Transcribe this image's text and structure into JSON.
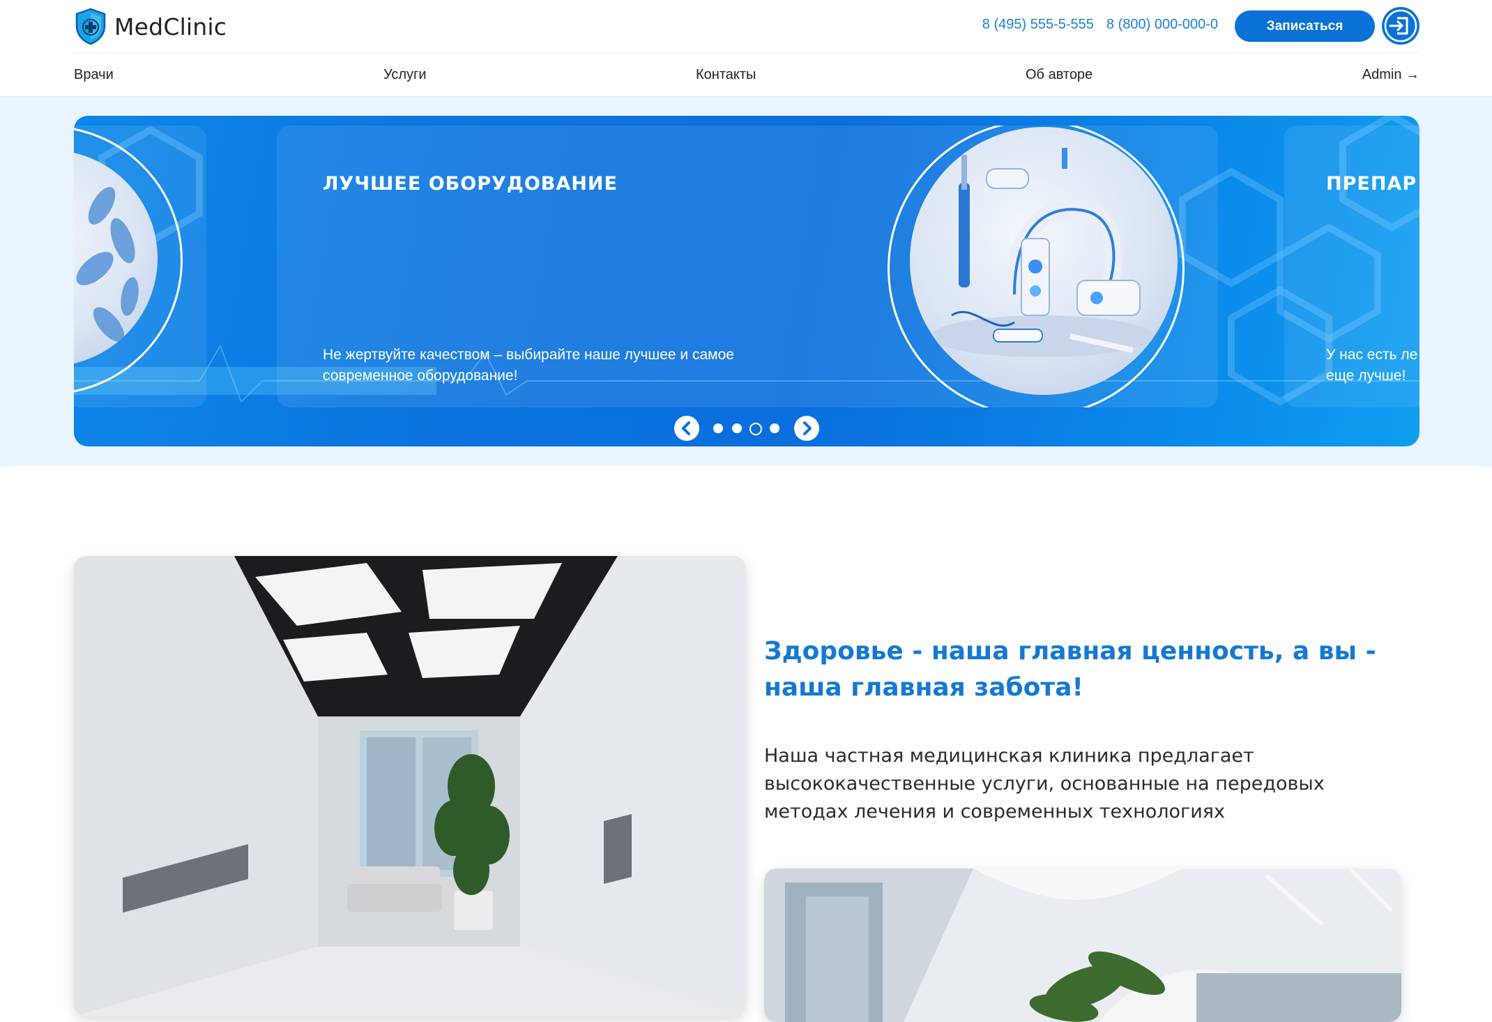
{
  "header": {
    "logo_text": "MedClinic",
    "phone_1": "8 (495) 555-5-555",
    "phone_2": "8 (800) 000-000-0",
    "signup_label": "Записаться"
  },
  "nav": {
    "items": [
      {
        "label": "Врачи"
      },
      {
        "label": "Услуги"
      },
      {
        "label": "Контакты"
      },
      {
        "label": "Об авторе"
      }
    ],
    "admin_label": "Admin →"
  },
  "slider": {
    "current": {
      "title": "ЛУЧШЕЕ ОБОРУДОВАНИЕ",
      "text": "Не жертвуйте качеством – выбирайте наше лучшее и самое современное оборудование!"
    },
    "next_partial": {
      "title": "ПРЕПАР",
      "text_line1": "У нас есть ле",
      "text_line2": "еще лучше!"
    },
    "dot_count": 4,
    "active_dot": 3
  },
  "about": {
    "headline": "Здоровье - наша главная ценность, а вы - наша главная забота!",
    "description": "Наша частная медицинская клиника предлагает высококачественные услуги, основанные на передовых методах лечения и современных технологиях"
  },
  "colors": {
    "primary": "#0a72d6",
    "link": "#1a7fd6",
    "band": "#eaf4fd",
    "headline": "#1479d2"
  }
}
